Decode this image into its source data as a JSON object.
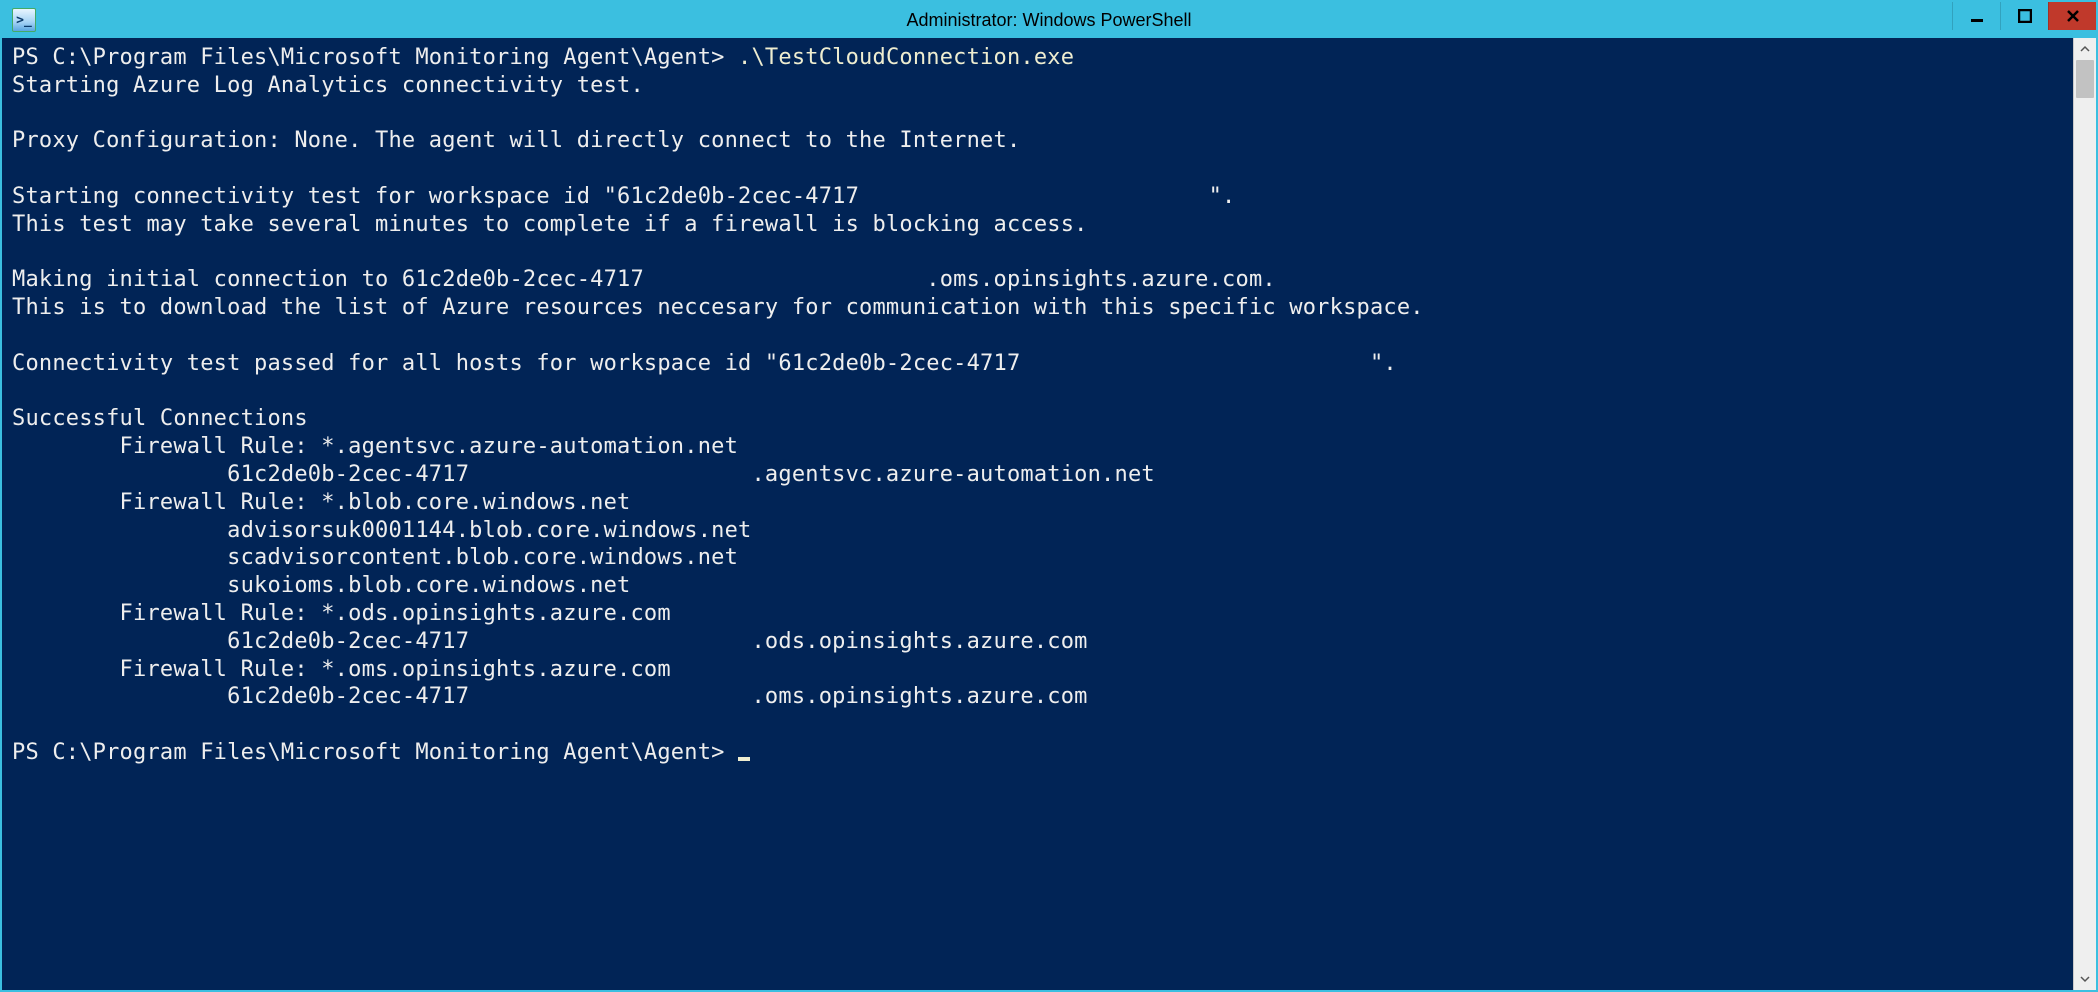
{
  "window": {
    "title": "Administrator: Windows PowerShell",
    "icon_glyph": ">_"
  },
  "console": {
    "prompt1": "PS C:\\Program Files\\Microsoft Monitoring Agent\\Agent> ",
    "command1": ".\\TestCloudConnection.exe",
    "lines": [
      "Starting Azure Log Analytics connectivity test.",
      "",
      "Proxy Configuration: None. The agent will directly connect to the Internet.",
      "",
      "Starting connectivity test for workspace id \"61c2de0b-2cec-4717                          \".",
      "This test may take several minutes to complete if a firewall is blocking access.",
      "",
      "Making initial connection to 61c2de0b-2cec-4717                     .oms.opinsights.azure.com.",
      "This is to download the list of Azure resources neccesary for communication with this specific workspace.",
      "",
      "Connectivity test passed for all hosts for workspace id \"61c2de0b-2cec-4717                          \".",
      "",
      "Successful Connections",
      "        Firewall Rule: *.agentsvc.azure-automation.net",
      "                61c2de0b-2cec-4717                     .agentsvc.azure-automation.net",
      "        Firewall Rule: *.blob.core.windows.net",
      "                advisorsuk0001144.blob.core.windows.net",
      "                scadvisorcontent.blob.core.windows.net",
      "                sukoioms.blob.core.windows.net",
      "        Firewall Rule: *.ods.opinsights.azure.com",
      "                61c2de0b-2cec-4717                     .ods.opinsights.azure.com",
      "        Firewall Rule: *.oms.opinsights.azure.com",
      "                61c2de0b-2cec-4717                     .oms.opinsights.azure.com",
      ""
    ],
    "prompt2": "PS C:\\Program Files\\Microsoft Monitoring Agent\\Agent> "
  }
}
